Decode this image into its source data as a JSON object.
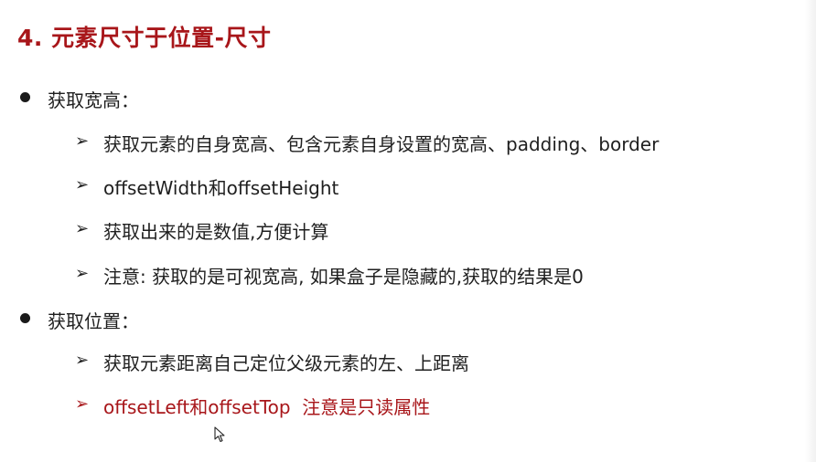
{
  "slide": {
    "title": "4. 元素尺寸于位置-尺寸",
    "sections": [
      {
        "heading": "获取宽高：",
        "items": [
          "获取元素的自身宽高、包含元素自身设置的宽高、padding、border",
          "offsetWidth和offsetHeight",
          "获取出来的是数值,方便计算",
          "注意: 获取的是可视宽高, 如果盒子是隐藏的,获取的结果是0"
        ]
      },
      {
        "heading": "获取位置：",
        "items": [
          "获取元素距离自己定位父级元素的左、上距离",
          "offsetLeft和offsetTop  注意是只读属性"
        ]
      }
    ],
    "arrow_glyph": "➢",
    "colors": {
      "title": "#a8161a",
      "highlight": "#a8161a",
      "text": "#1f1f1f"
    },
    "icons": [
      "bullet-dot-icon",
      "arrow-bullet-icon",
      "mouse-pointer-icon"
    ]
  }
}
